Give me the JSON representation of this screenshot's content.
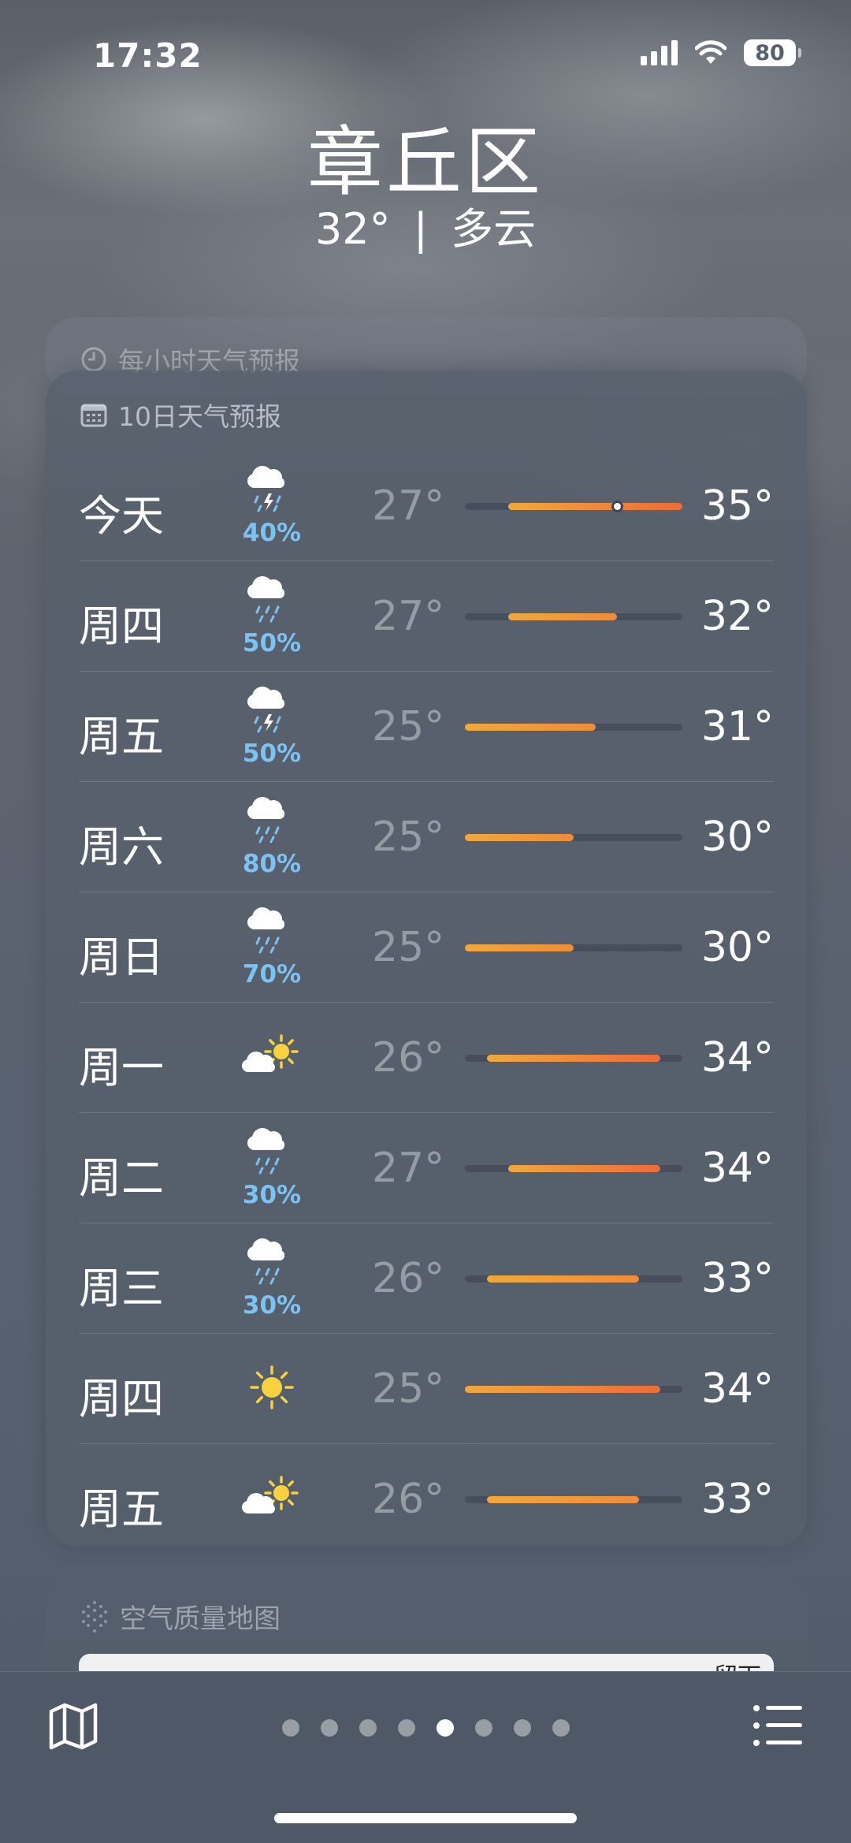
{
  "status_bar": {
    "time": "17:32",
    "battery": "80"
  },
  "location": {
    "city": "章丘区",
    "current_temp": "32°",
    "separator": "|",
    "condition": "多云"
  },
  "hourly_card": {
    "title": "每小时天气预报"
  },
  "forecast": {
    "title": "10日天气预报",
    "range_min": 25,
    "range_max": 35,
    "current_temp": 32,
    "days": [
      {
        "day": "今天",
        "icon": "thunderstorm-icon",
        "pop": "40%",
        "low": "27°",
        "high": "35°",
        "low_v": 27,
        "high_v": 35
      },
      {
        "day": "周四",
        "icon": "rain-icon",
        "pop": "50%",
        "low": "27°",
        "high": "32°",
        "low_v": 27,
        "high_v": 32
      },
      {
        "day": "周五",
        "icon": "thunderstorm-icon",
        "pop": "50%",
        "low": "25°",
        "high": "31°",
        "low_v": 25,
        "high_v": 31
      },
      {
        "day": "周六",
        "icon": "rain-icon",
        "pop": "80%",
        "low": "25°",
        "high": "30°",
        "low_v": 25,
        "high_v": 30
      },
      {
        "day": "周日",
        "icon": "rain-icon",
        "pop": "70%",
        "low": "25°",
        "high": "30°",
        "low_v": 25,
        "high_v": 30
      },
      {
        "day": "周一",
        "icon": "partly-sunny-icon",
        "pop": "",
        "low": "26°",
        "high": "34°",
        "low_v": 26,
        "high_v": 34
      },
      {
        "day": "周二",
        "icon": "rain-icon",
        "pop": "30%",
        "low": "27°",
        "high": "34°",
        "low_v": 27,
        "high_v": 34
      },
      {
        "day": "周三",
        "icon": "rain-icon",
        "pop": "30%",
        "low": "26°",
        "high": "33°",
        "low_v": 26,
        "high_v": 33
      },
      {
        "day": "周四",
        "icon": "sun-icon",
        "pop": "",
        "low": "25°",
        "high": "34°",
        "low_v": 25,
        "high_v": 34
      },
      {
        "day": "周五",
        "icon": "partly-sunny-icon",
        "pop": "",
        "low": "26°",
        "high": "33°",
        "low_v": 26,
        "high_v": 33
      }
    ]
  },
  "air_quality": {
    "title": "空气质量地图",
    "map_label": "留下"
  },
  "bottom_bar": {
    "page_count": 8,
    "active_page": 5
  }
}
